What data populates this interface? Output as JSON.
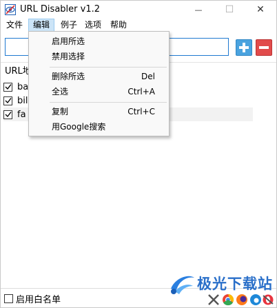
{
  "window": {
    "title": "URL Disabler v1.2",
    "min_glyph": "—",
    "max_glyph": "☐",
    "close_glyph": "✕"
  },
  "menubar": [
    {
      "label": "文件",
      "active": false
    },
    {
      "label": "编辑",
      "active": true
    },
    {
      "label": "例子",
      "active": false
    },
    {
      "label": "选项",
      "active": false
    },
    {
      "label": "帮助",
      "active": false
    }
  ],
  "url_input": {
    "value": "",
    "placeholder": ""
  },
  "toolbar": {
    "add_icon": "plus-icon",
    "remove_icon": "minus-icon"
  },
  "list": {
    "header": "URL地",
    "rows": [
      {
        "text": "ba",
        "checked": true
      },
      {
        "text": "bil",
        "checked": true
      },
      {
        "text": "fa",
        "checked": true
      }
    ]
  },
  "edit_menu": {
    "items": [
      {
        "label": "启用所选",
        "shortcut": ""
      },
      {
        "label": "禁用选择",
        "shortcut": ""
      },
      {
        "label": "删除所选",
        "shortcut": "Del"
      },
      {
        "label": "全选",
        "shortcut": "Ctrl+A"
      },
      {
        "label": "复制",
        "shortcut": "Ctrl+C"
      },
      {
        "label": "用Google搜索",
        "shortcut": ""
      }
    ]
  },
  "footer": {
    "whitelist_label": "启用白名单",
    "whitelist_checked": false
  },
  "watermark": {
    "text": "极光下载站"
  },
  "colors": {
    "accent": "#1e78d0",
    "add": "#4aa3df",
    "remove": "#e14b4b",
    "menu_highlight": "#cce4f7"
  }
}
